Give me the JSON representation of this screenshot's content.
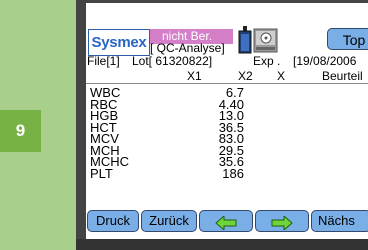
{
  "step": {
    "number": "9"
  },
  "header": {
    "logo_text": "Sysmex",
    "status_text": "nicht Ber.",
    "mode_text": "[ QC-Analyse]",
    "top_button_label": "Top",
    "icons": [
      "reagent-bottle-icon",
      "drive-icon"
    ],
    "colors": {
      "status_bg": "#d57fc8",
      "button_bg": "#7aaee6",
      "logo": "#2a66c8"
    }
  },
  "info": {
    "file": "File[1]",
    "lot": "Lot[  61320822]",
    "exp": "Exp .",
    "date": "[19/08/2006",
    "x1": "X1",
    "x2": "X2",
    "x": "X",
    "beurteil": "Beurteil"
  },
  "results": [
    {
      "param": "WBC",
      "value": "6.7"
    },
    {
      "param": "RBC",
      "value": "4.40"
    },
    {
      "param": "HGB",
      "value": "13.0"
    },
    {
      "param": "HCT",
      "value": "36.5"
    },
    {
      "param": "MCV",
      "value": "83.0"
    },
    {
      "param": "MCH",
      "value": "29.5"
    },
    {
      "param": "MCHC",
      "value": "35.6"
    },
    {
      "param": "PLT",
      "value": "186"
    }
  ],
  "buttons": {
    "druck": "Druck",
    "zurueck": "Zurück",
    "prev_icon": "arrow-left-icon",
    "next_icon": "arrow-right-icon",
    "naechste": "Nächs"
  }
}
